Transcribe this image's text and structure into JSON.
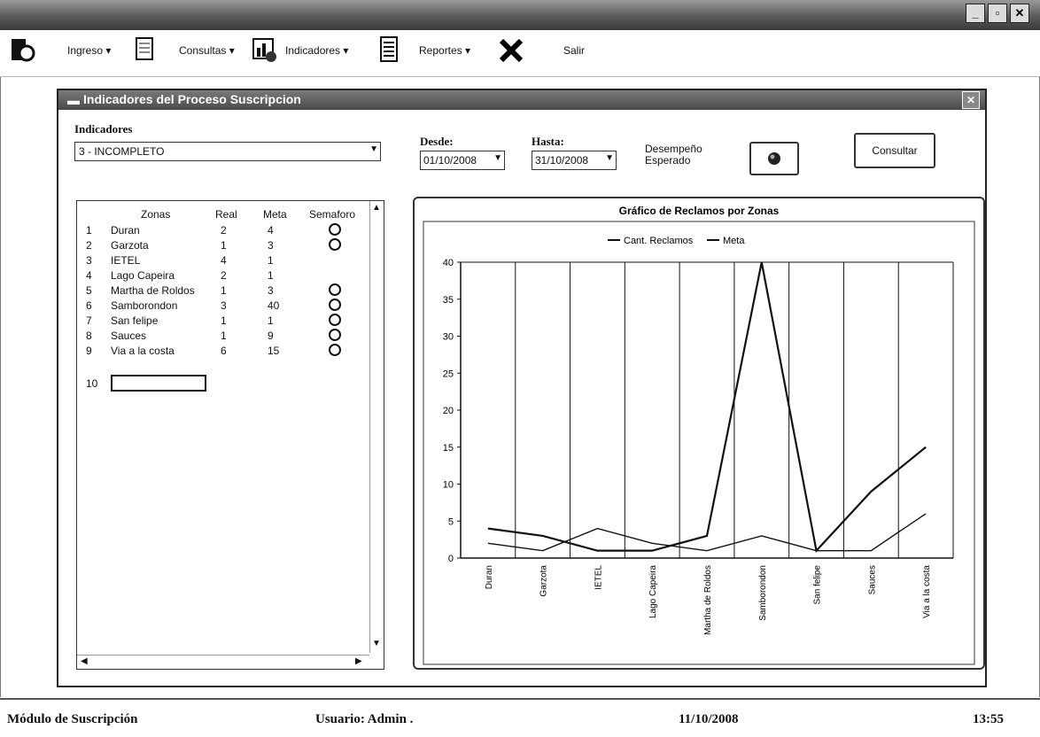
{
  "menu": {
    "ingreso": "Ingreso",
    "consultas": "Consultas",
    "indicadores": "Indicadores",
    "reportes": "Reportes",
    "salir": "Salir",
    "arrow": "▾"
  },
  "window": {
    "title": "Indicadores del Proceso Suscripcion"
  },
  "form": {
    "indicadores_label": "Indicadores",
    "indicadores_value": "3 - INCOMPLETO",
    "desde_label": "Desde:",
    "desde_value": "01/10/2008",
    "hasta_label": "Hasta:",
    "hasta_value": "31/10/2008",
    "desempeno_label": "Desempeño Esperado",
    "consultar_label": "Consultar"
  },
  "grid": {
    "headers": {
      "zonas": "Zonas",
      "real": "Real",
      "meta": "Meta",
      "semaforo": "Semaforo"
    },
    "rows": [
      {
        "n": "1",
        "zona": "Duran",
        "real": "2",
        "meta": "4",
        "semaforo": true
      },
      {
        "n": "2",
        "zona": "Garzota",
        "real": "1",
        "meta": "3",
        "semaforo": true
      },
      {
        "n": "3",
        "zona": "IETEL",
        "real": "4",
        "meta": "1",
        "semaforo": false
      },
      {
        "n": "4",
        "zona": "Lago Capeira",
        "real": "2",
        "meta": "1",
        "semaforo": false
      },
      {
        "n": "5",
        "zona": "Martha de Roldos",
        "real": "1",
        "meta": "3",
        "semaforo": true
      },
      {
        "n": "6",
        "zona": "Samborondon",
        "real": "3",
        "meta": "40",
        "semaforo": true
      },
      {
        "n": "7",
        "zona": "San felipe",
        "real": "1",
        "meta": "1",
        "semaforo": true
      },
      {
        "n": "8",
        "zona": "Sauces",
        "real": "1",
        "meta": "9",
        "semaforo": true
      },
      {
        "n": "9",
        "zona": "Via a la costa",
        "real": "6",
        "meta": "15",
        "semaforo": true
      }
    ],
    "new_row_n": "10"
  },
  "chart_data": {
    "type": "line",
    "title": "Gráfico de Reclamos por Zonas",
    "categories": [
      "Duran",
      "Garzota",
      "IETEL",
      "Lago Capeira",
      "Martha de Roldos",
      "Samborondon",
      "San felipe",
      "Sauces",
      "Via a la costa"
    ],
    "series": [
      {
        "name": "Cant. Reclamos",
        "values": [
          2,
          1,
          4,
          2,
          1,
          3,
          1,
          1,
          6
        ]
      },
      {
        "name": "Meta",
        "values": [
          4,
          3,
          1,
          1,
          3,
          40,
          1,
          9,
          15
        ]
      }
    ],
    "ylim": [
      0,
      40
    ],
    "yticks": [
      0,
      5,
      10,
      15,
      20,
      25,
      30,
      35,
      40
    ],
    "legend": "top",
    "grid": "vertical"
  },
  "status": {
    "module": "Módulo de Suscripción",
    "user": "Usuario:  Admin .",
    "date": "11/10/2008",
    "time": "13:55"
  }
}
